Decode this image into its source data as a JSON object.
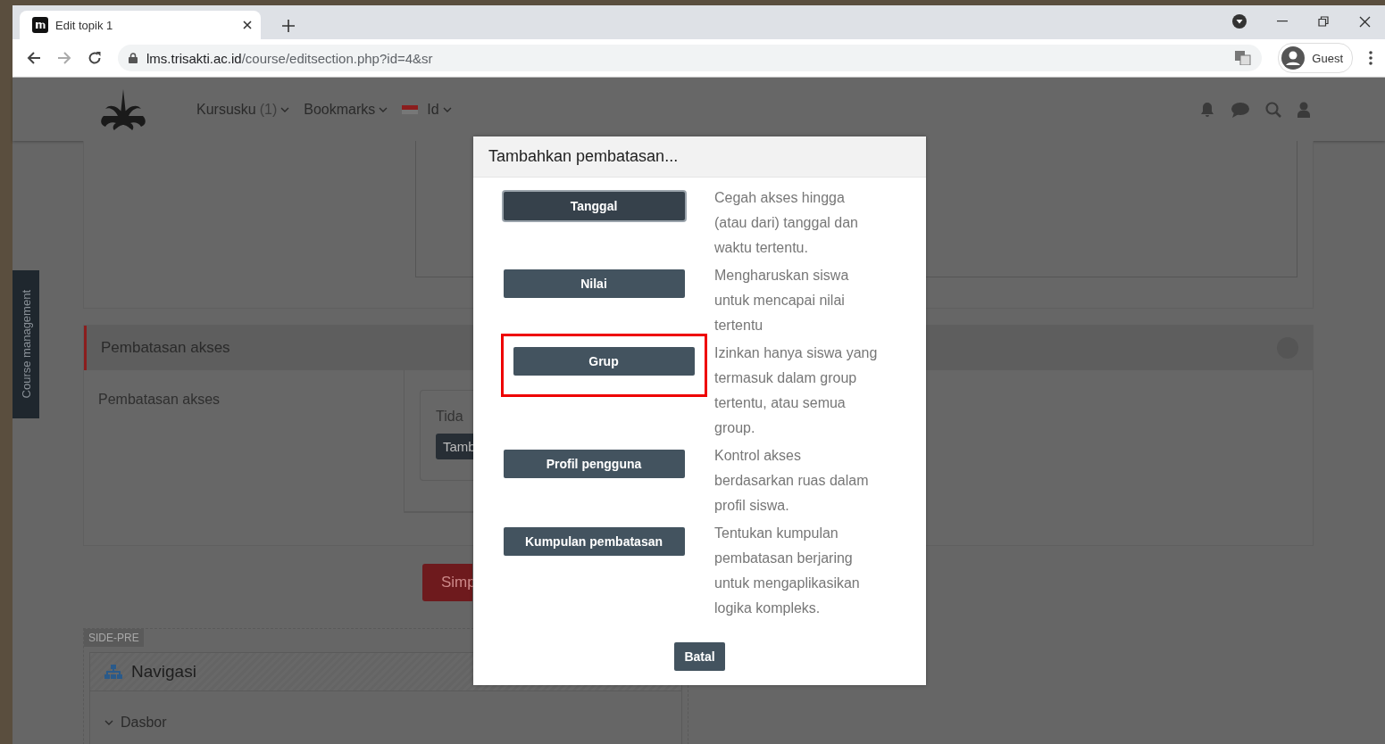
{
  "browser": {
    "tab_title": "Edit topik 1",
    "url_host": "lms.trisakti.ac.id",
    "url_path": "/course/editsection.php?id=4&sr",
    "profile": "Guest"
  },
  "navbar": {
    "items": [
      {
        "label": "Kursusku",
        "count": "(1)",
        "flag": false
      },
      {
        "label": "Bookmarks",
        "flag": false
      },
      {
        "label": "Id",
        "flag": true
      }
    ]
  },
  "side_tab": "Course management",
  "section": {
    "title": "Pembatasan akses",
    "expanded": true,
    "field_label": "Pembatasan akses",
    "text": "Tida",
    "button": "Tamb"
  },
  "save_button": "Simp",
  "side_pre": {
    "label": "SIDE-PRE",
    "block_title": "Navigasi",
    "items": [
      {
        "label": "Dasbor",
        "expanded": true
      }
    ]
  },
  "dialog": {
    "title": "Tambahkan pembatasan...",
    "options": [
      {
        "label": "Tanggal",
        "description": "Cegah akses hingga (atau dari) tanggal dan waktu tertentu.",
        "focused": true,
        "highlighted": false
      },
      {
        "label": "Nilai",
        "description": "Mengharuskan siswa untuk mencapai nilai tertentu",
        "focused": false,
        "highlighted": false
      },
      {
        "label": "Grup",
        "description": "Izinkan hanya siswa yang termasuk dalam group tertentu, atau semua group.",
        "focused": false,
        "highlighted": true
      },
      {
        "label": "Profil pengguna",
        "description": "Kontrol akses berdasarkan ruas dalam profil siswa.",
        "focused": false,
        "highlighted": false
      },
      {
        "label": "Kumpulan pembatasan",
        "description": "Tentukan kumpulan pembatasan berjaring untuk mengaplikasikan logika kompleks.",
        "focused": false,
        "highlighted": false
      }
    ],
    "cancel": "Batal"
  }
}
